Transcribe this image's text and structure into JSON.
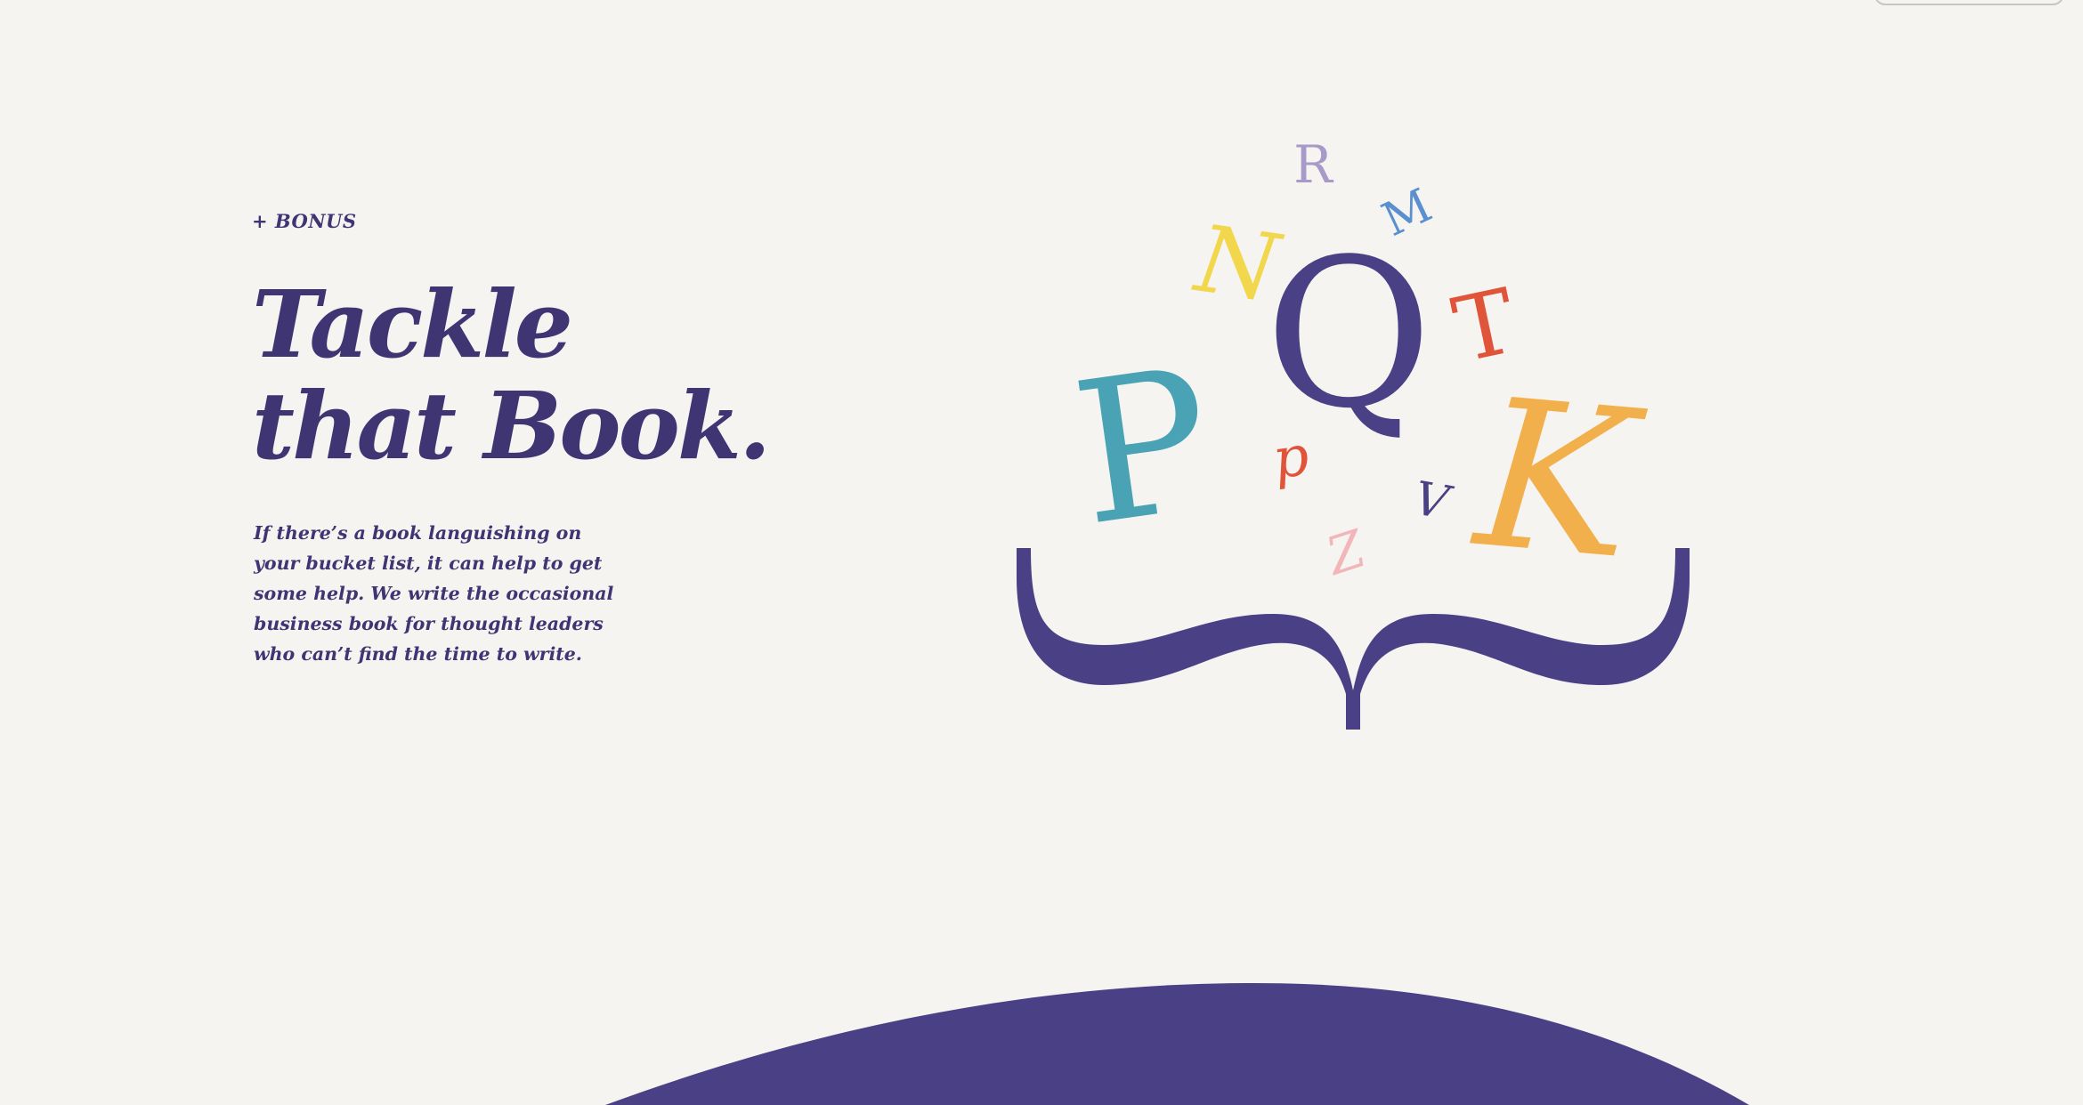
{
  "hero": {
    "eyebrow": "+ BONUS",
    "headline_line1": "Tackle",
    "headline_line2": "that Book.",
    "body": "If there’s a book languishing on your bucket list, it can help to get some help. We write the occasional business book for thought leaders who can’t find the time to write."
  },
  "illustration": {
    "letters": [
      "R",
      "M",
      "N",
      "Q",
      "T",
      "P",
      "p",
      "K",
      "V",
      "Z"
    ],
    "brace_color": "#4a4085"
  },
  "colors": {
    "background": "#f5f4f1",
    "text": "#3f3573",
    "accent_purple": "#4a4085",
    "teal": "#4aa3b4",
    "yellow": "#f2d64b",
    "orange": "#f2b04c",
    "red": "#e0553a",
    "lavender": "#a89ac8",
    "blue": "#5a8fd0",
    "pink": "#f2b6b8"
  }
}
